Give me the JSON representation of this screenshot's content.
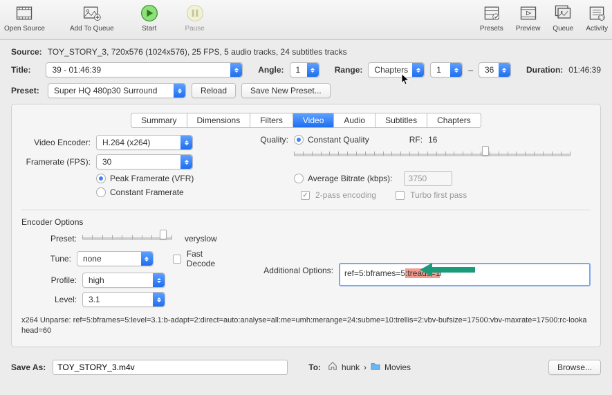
{
  "toolbar": {
    "open_source": "Open Source",
    "add_to_queue": "Add To Queue",
    "start": "Start",
    "pause": "Pause",
    "presets": "Presets",
    "preview": "Preview",
    "queue": "Queue",
    "activity": "Activity"
  },
  "source": {
    "label": "Source:",
    "value": "TOY_STORY_3, 720x576 (1024x576), 25 FPS, 5 audio tracks, 24 subtitles tracks"
  },
  "title": {
    "label": "Title:",
    "value": "39 - 01:46:39"
  },
  "angle": {
    "label": "Angle:",
    "value": "1"
  },
  "range": {
    "label": "Range:",
    "type": "Chapters",
    "from": "1",
    "sep": "–",
    "to": "36"
  },
  "duration": {
    "label": "Duration:",
    "value": "01:46:39"
  },
  "preset": {
    "label": "Preset:",
    "value": "Super HQ 480p30 Surround",
    "reload": "Reload",
    "save_new": "Save New Preset..."
  },
  "tabs": [
    "Summary",
    "Dimensions",
    "Filters",
    "Video",
    "Audio",
    "Subtitles",
    "Chapters"
  ],
  "active_tab": 3,
  "video": {
    "encoder_label": "Video Encoder:",
    "encoder": "H.264 (x264)",
    "framerate_label": "Framerate (FPS):",
    "framerate": "30",
    "peak": "Peak Framerate (VFR)",
    "constant_fr": "Constant Framerate",
    "quality_label": "Quality:",
    "constant_quality": "Constant Quality",
    "rf_label": "RF:",
    "rf": "16",
    "avg_bitrate": "Average Bitrate (kbps):",
    "bitrate": "3750",
    "two_pass": "2-pass encoding",
    "turbo": "Turbo first pass"
  },
  "enc": {
    "section": "Encoder Options",
    "preset_label": "Preset:",
    "preset_value": "veryslow",
    "tune_label": "Tune:",
    "tune": "none",
    "fast_decode": "Fast Decode",
    "profile_label": "Profile:",
    "profile": "high",
    "level_label": "Level:",
    "level": "3.1",
    "addopt_label": "Additional Options:",
    "addopt_prefix": "ref=5:bframes=5",
    "addopt_hl": ":treads=1"
  },
  "unparse": "x264 Unparse: ref=5:bframes=5:level=3.1:b-adapt=2:direct=auto:analyse=all:me=umh:merange=24:subme=10:trellis=2:vbv-bufsize=17500:vbv-maxrate=17500:rc-lookahead=60",
  "saveas": {
    "label": "Save As:",
    "file": "TOY_STORY_3.m4v",
    "to": "To:",
    "user": "hunk",
    "sep": "›",
    "folder": "Movies",
    "browse": "Browse..."
  }
}
